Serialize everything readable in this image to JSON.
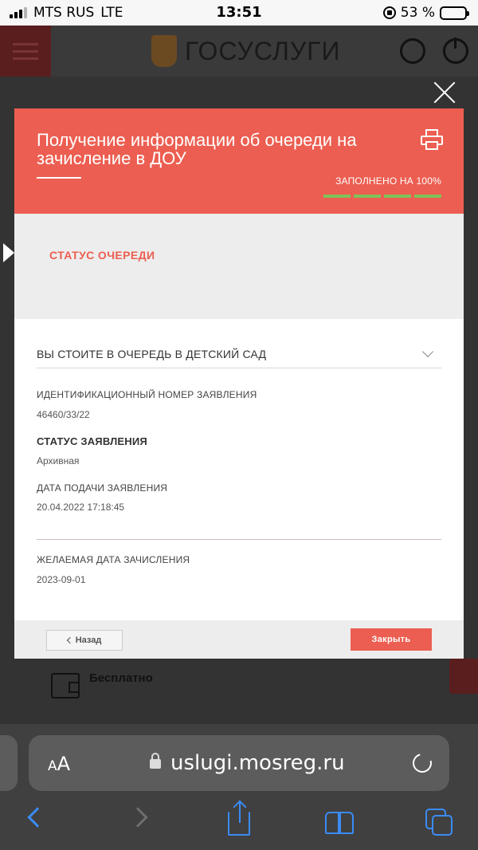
{
  "status_bar": {
    "carrier": "MTS RUS",
    "network": "LTE",
    "time": "13:51",
    "battery": "53 %",
    "battery_level": 0.53
  },
  "site": {
    "title": "ГОСУСЛУГИ"
  },
  "modal": {
    "title": "Получение информации об очереди на зачисление в ДОУ",
    "filled": "ЗАПОЛНЕНО НА 100%",
    "progress_percent": 100,
    "section_title": "СТАТУС ОЧЕРЕДИ",
    "dropdown_label": "ВЫ СТОИТЕ В ОЧЕРЕДЬ В ДЕТСКИЙ САД",
    "fields": [
      {
        "label": "ИДЕНТИФИКАЦИОННЫЙ НОМЕР ЗАЯВЛЕНИЯ",
        "value": "46460/33/22"
      },
      {
        "label": "СТАТУС ЗАЯВЛЕНИЯ",
        "value": "Архивная"
      },
      {
        "label": "ДАТА ПОДАЧИ ЗАЯВЛЕНИЯ",
        "value": "20.04.2022 17:18:45"
      },
      {
        "label": "ЖЕЛАЕМАЯ ДАТА ЗАЧИСЛЕНИЯ",
        "value": "2023-09-01"
      }
    ],
    "back_label": "Назад",
    "close_label": "Закрыть"
  },
  "page_behind": {
    "price_label": "Бесплатно"
  },
  "browser": {
    "aa_label_small": "A",
    "aa_label_big": "A",
    "url": "uslugi.mosreg.ru"
  },
  "colors": {
    "accent": "#ec5e51",
    "progress": "#7fc25a",
    "ios_blue": "#3b8bf5"
  }
}
